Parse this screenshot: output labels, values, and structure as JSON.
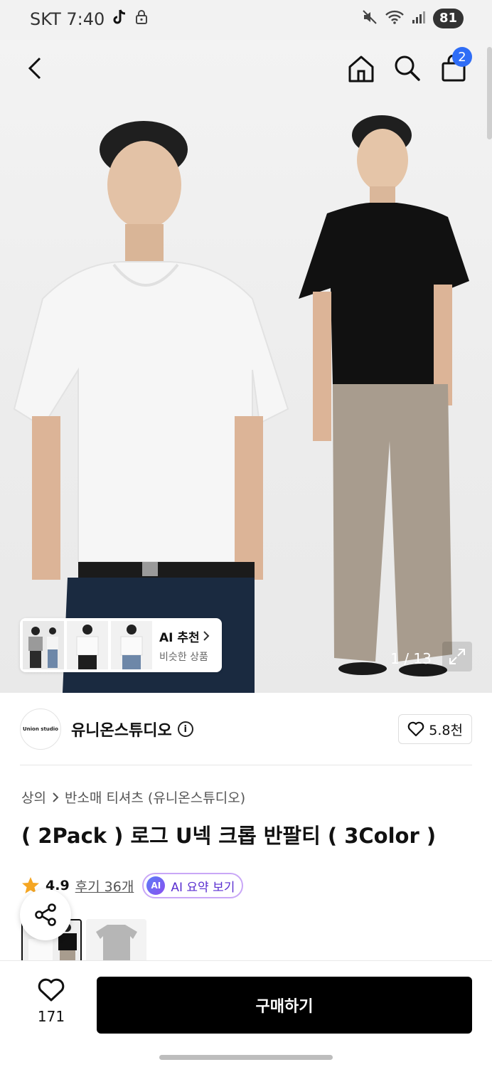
{
  "status_bar": {
    "carrier_time": "SKT 7:40",
    "battery": "81"
  },
  "header": {
    "cart_badge": "2"
  },
  "gallery": {
    "ai_card": {
      "title": "AI 추천",
      "subtitle": "비슷한 상품"
    },
    "counter": "1 / 13"
  },
  "brand": {
    "logo_text": "Union studio",
    "name": "유니온스튜디오",
    "likes": "5.8천"
  },
  "breadcrumb": {
    "root": "상의",
    "category": "반소매 티셔츠 (유니온스튜디오)"
  },
  "product": {
    "title": "( 2Pack ) 로그 U넥 크롭 반팔티 ( 3Color )"
  },
  "rating": {
    "score": "4.9",
    "reviews": "후기 36개",
    "ai_badge": "AI",
    "ai_summary": "AI 요약 보기"
  },
  "bottom": {
    "wish_count": "171",
    "buy_label": "구매하기"
  },
  "colors": {
    "accent_blue": "#2f6df6",
    "ai_purple": "#5a2fd0",
    "star": "#f5a623"
  }
}
